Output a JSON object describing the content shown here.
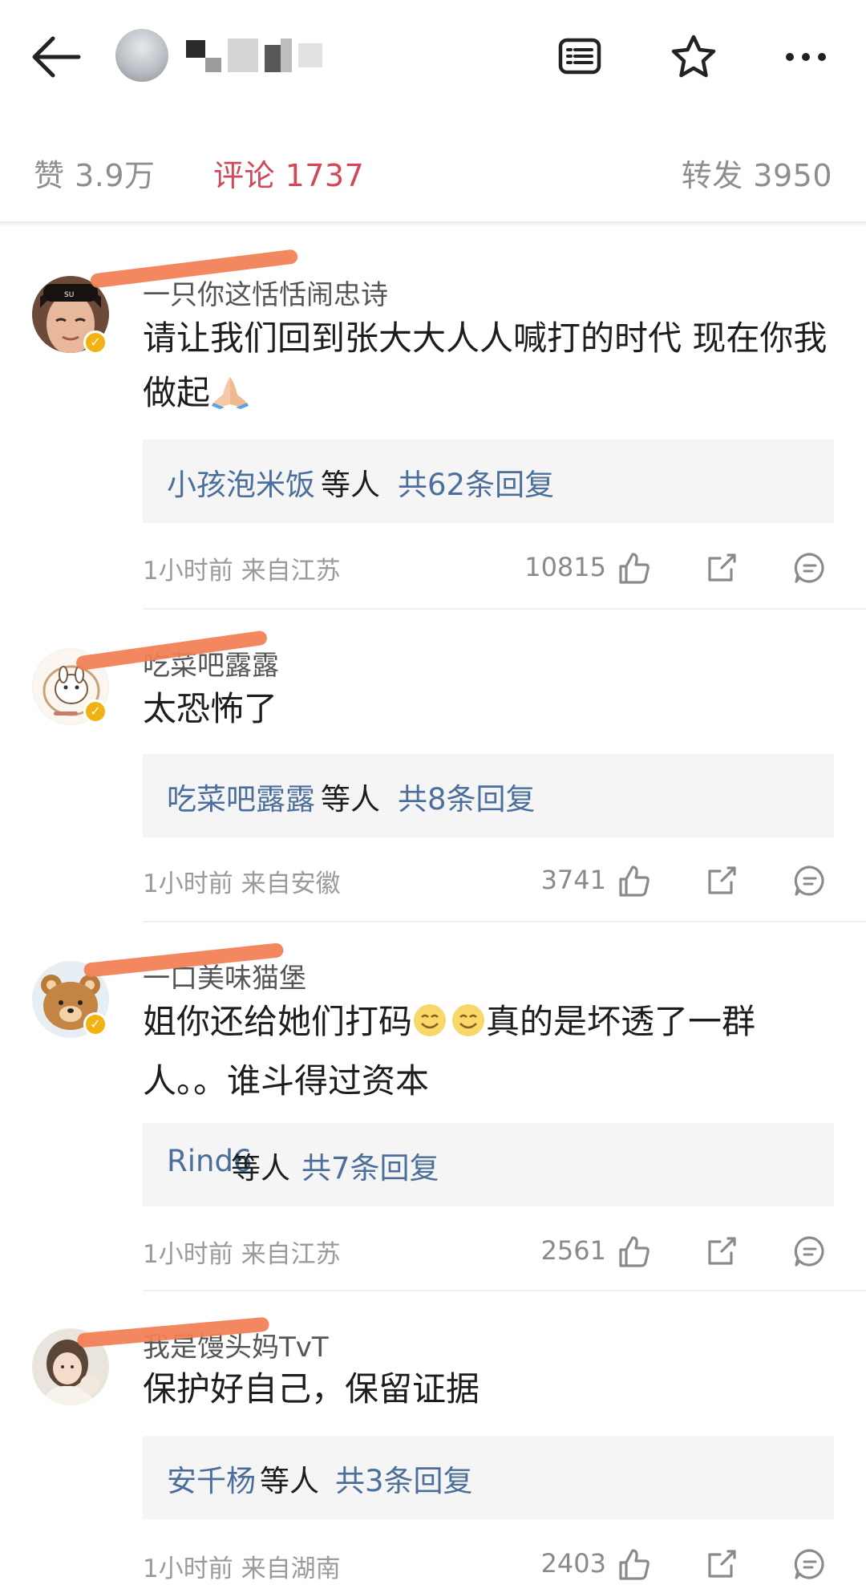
{
  "stats": {
    "likes": "赞 3.9万",
    "comments": "评论 1737",
    "reposts": "转发 3950"
  },
  "colors": {
    "accent_red": "#d2485a",
    "reply_link_blue": "#4b6f9a",
    "verified_badge": "#f2b211",
    "redaction_stroke": "#f27e54"
  },
  "comments": [
    {
      "username": "一只你这恬恬闹忠诗",
      "text_part1": "请让我们回到张大大人人喊打的时代 现在你我做起",
      "emoji": "folded-hands-icon",
      "reply_user": "小孩泡米饭",
      "reply_mid": " 等人 ",
      "reply_count": "共62条回复",
      "time_location": "1小时前  来自江苏",
      "likes": "10815"
    },
    {
      "username": "吃菜吧露露",
      "text_part1": "太恐怖了",
      "reply_user": "吃菜吧露露",
      "reply_mid": " 等人 ",
      "reply_count": "共8条回复",
      "time_location": "1小时前  来自安徽",
      "likes": "3741"
    },
    {
      "username": "一口美味猫堡",
      "text_part1": "姐你还给她们打码",
      "text_part2": "真的是坏透了一群人。。谁斗得过资本",
      "emoji": "smiling-face-icon",
      "reply_user": "Rind6",
      "reply_mid": " 等人 ",
      "reply_count": "共7条回复",
      "time_location": "1小时前  来自江苏",
      "likes": "2561"
    },
    {
      "username": "我是馒头妈TvT",
      "text_part1": "保护好自己，保留证据",
      "reply_user": "安千杨",
      "reply_mid": " 等人 ",
      "reply_count": "共3条回复",
      "time_location": "1小时前  来自湖南",
      "likes": "2403"
    }
  ]
}
